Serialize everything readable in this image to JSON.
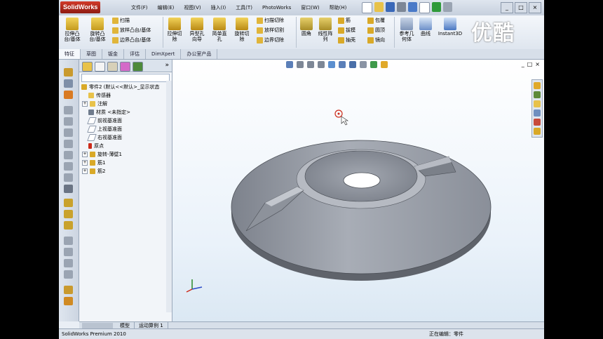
{
  "app": {
    "logo": "SolidWorks"
  },
  "menu": [
    "文件(F)",
    "编辑(E)",
    "视图(V)",
    "插入(I)",
    "工具(T)",
    "PhotoWorks",
    "窗口(W)",
    "帮助(H)"
  ],
  "window_buttons": [
    "_",
    "□",
    "×"
  ],
  "watermark": "优酷",
  "ribbon": {
    "extrude_boss": "拉伸凸\n台/基体",
    "revolve_boss": "旋转凸\n台/基体",
    "sweep": "扫描",
    "loft": "放样凸台/基体",
    "boundary_boss": "边界凸台/基体",
    "extrude_cut": "拉伸切\n除",
    "hole_wizard": "异型孔\n向导",
    "revolve_cut": "旋转切\n除",
    "simple_hole": "简单直\n孔",
    "swept_cut": "扫描切除",
    "lofted_cut": "放样切割",
    "boundary_cut": "边界切除",
    "fillet": "圆角",
    "linear_pattern": "线性阵\n列",
    "rib": "筋",
    "draft": "拔模",
    "shell": "抽壳",
    "wrap": "包覆",
    "dome": "圆顶",
    "mirror": "镜向",
    "ref_geometry": "参考几\n何体",
    "curves": "曲线",
    "instant3d": "Instant3D"
  },
  "tabs": [
    {
      "label": "特征",
      "active": true
    },
    {
      "label": "草图",
      "active": false
    },
    {
      "label": "钣金",
      "active": false
    },
    {
      "label": "评估",
      "active": false
    },
    {
      "label": "DimXpert",
      "active": false
    },
    {
      "label": "办公室产品",
      "active": false
    }
  ],
  "tree": {
    "root": "零件2 (默认<<默认>_显示状态",
    "items": [
      {
        "label": "传感器",
        "expand": ""
      },
      {
        "label": "注解",
        "expand": "+"
      },
      {
        "label": "材质 <未指定>",
        "expand": ""
      },
      {
        "label": "前视基准面",
        "expand": ""
      },
      {
        "label": "上视基准面",
        "expand": ""
      },
      {
        "label": "右视基准面",
        "expand": ""
      },
      {
        "label": "原点",
        "expand": ""
      },
      {
        "label": "旋转-薄壁1",
        "expand": "+"
      },
      {
        "label": "筋1",
        "expand": "+"
      },
      {
        "label": "筋2",
        "expand": "+"
      }
    ]
  },
  "bottom_tabs": [
    "模型",
    "运动算例 1"
  ],
  "status": {
    "left": "SolidWorks Premium 2010",
    "right": "正在编辑：零件"
  },
  "colors": {
    "model": "#8e939d",
    "accent": "#cc2a1a"
  }
}
